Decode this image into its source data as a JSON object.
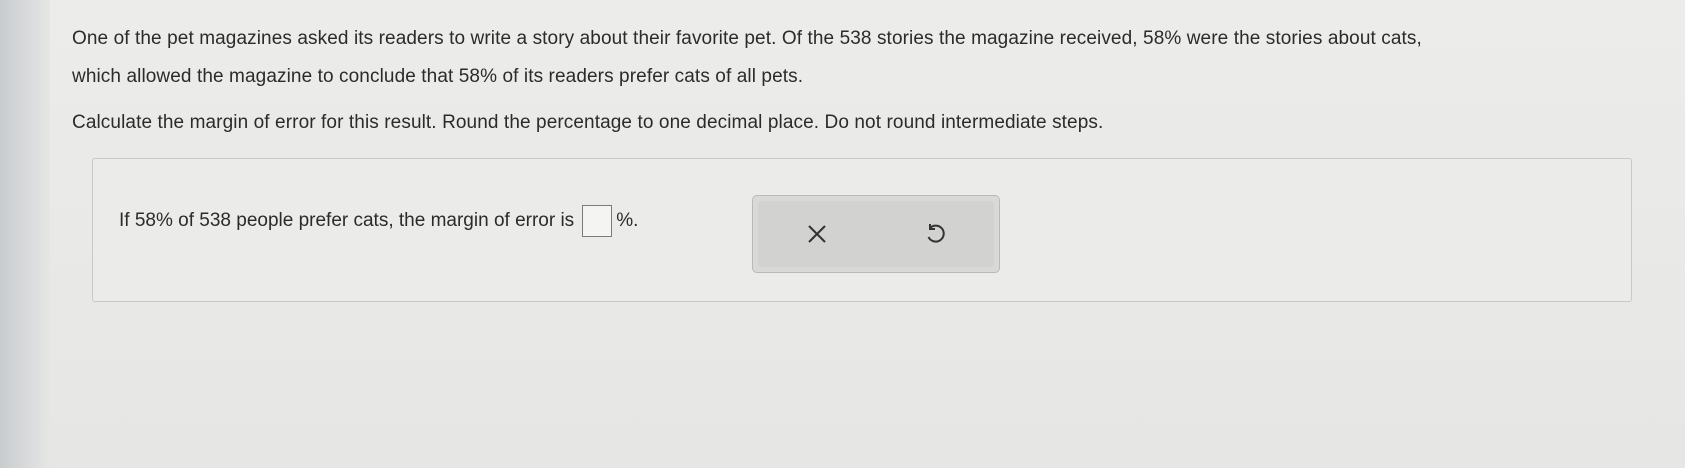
{
  "question": {
    "line1": "One of the pet magazines asked its readers to write a story about their favorite pet. Of the 538 stories the magazine received, 58% were the stories about cats,",
    "line2": "which allowed the magazine to conclude that 58% of its readers prefer cats of all pets.",
    "instruction": "Calculate the margin of error for this result. Round the percentage to one decimal place. Do not round intermediate steps."
  },
  "answer": {
    "prefix": "If 58% of 538 people prefer cats, the margin of error is",
    "value": "",
    "suffix": "%."
  },
  "buttons": {
    "clear_icon": "x-icon",
    "reset_icon": "undo-icon"
  }
}
